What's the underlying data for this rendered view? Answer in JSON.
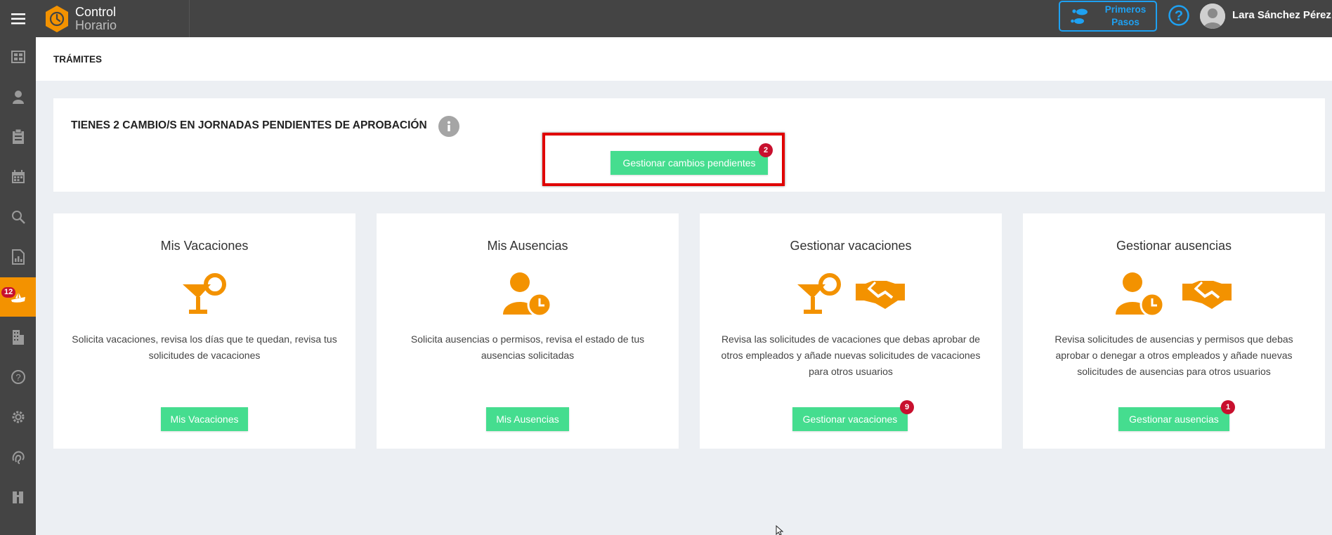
{
  "header": {
    "brand_line1": "Control",
    "brand_line2": "Horario",
    "first_steps_label": "Primeros Pasos",
    "user_name": "Lara Sánchez Pérez"
  },
  "sidebar": {
    "items": [
      {
        "icon": "dashboard-icon"
      },
      {
        "icon": "user-icon"
      },
      {
        "icon": "clipboard-icon"
      },
      {
        "icon": "calendar-icon"
      },
      {
        "icon": "search-icon"
      },
      {
        "icon": "report-icon"
      },
      {
        "icon": "vacation-icon",
        "badge": "12",
        "active": true
      },
      {
        "icon": "building-icon"
      },
      {
        "icon": "help-icon"
      },
      {
        "icon": "gear-icon"
      },
      {
        "icon": "fingerprint-icon"
      },
      {
        "icon": "tools-icon"
      }
    ]
  },
  "page": {
    "title": "TRÁMITES"
  },
  "pending": {
    "title": "TIENES 2 CAMBIO/S EN JORNADAS PENDIENTES DE APROBACIÓN",
    "button_label": "Gestionar cambios pendientes",
    "badge": "2"
  },
  "cards": [
    {
      "title": "Mis Vacaciones",
      "description": "Solicita vacaciones, revisa los días que te quedan, revisa tus solicitudes de vacaciones",
      "button_label": "Mis Vacaciones"
    },
    {
      "title": "Mis Ausencias",
      "description": "Solicita ausencias o permisos, revisa el estado de tus ausencias solicitadas",
      "button_label": "Mis Ausencias"
    },
    {
      "title": "Gestionar vacaciones",
      "description": "Revisa las solicitudes de vacaciones que debas aprobar de otros empleados y añade nuevas solicitudes de vacaciones para otros usuarios",
      "button_label": "Gestionar vacaciones",
      "badge": "9"
    },
    {
      "title": "Gestionar ausencias",
      "description": "Revisa solicitudes de ausencias y permisos que debas aprobar o denegar a otros empleados y añade nuevas solicitudes de ausencias para otros usuarios",
      "button_label": "Gestionar ausencias",
      "badge": "1"
    }
  ],
  "colors": {
    "topbar": "#444444",
    "accent_orange": "#f39200",
    "button_green": "#45dd8f",
    "badge_red": "#c8102e",
    "highlight_red": "#e00000",
    "link_blue": "#1ea1f2"
  }
}
